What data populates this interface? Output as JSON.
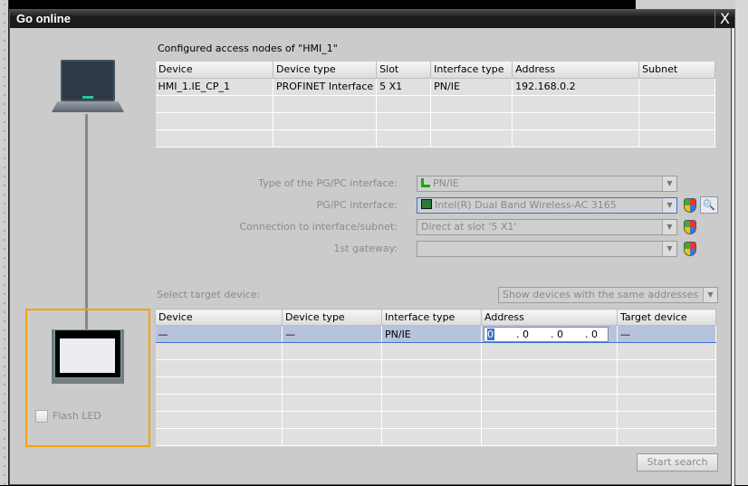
{
  "dialog": {
    "title": "Go online",
    "close_label": "X"
  },
  "configured": {
    "title": "Configured access nodes of \"HMI_1\"",
    "headers": [
      "Device",
      "Device type",
      "Slot",
      "Interface type",
      "Address",
      "Subnet"
    ],
    "rows": [
      [
        "HMI_1.IE_CP_1",
        "PROFINET Interface",
        "5 X1",
        "PN/IE",
        "192.168.0.2",
        ""
      ]
    ]
  },
  "form": {
    "type_label": "Type of the PG/PC interface:",
    "type_value": "PN/IE",
    "pgpc_label": "PG/PC interface:",
    "pgpc_value": "Intel(R) Dual Band Wireless-AC 3165",
    "conn_label": "Connection to interface/subnet:",
    "conn_value": "Direct at slot '5 X1'",
    "gateway_label": "1st gateway:",
    "gateway_value": ""
  },
  "target": {
    "label": "Select target device:",
    "filter": "Show devices with the same addresses",
    "headers": [
      "Device",
      "Device type",
      "Interface type",
      "Address",
      "Target device"
    ],
    "row": {
      "device": "—",
      "device_type": "—",
      "interface_type": "PN/IE",
      "address": [
        "0",
        ". 0",
        ". 0",
        ". 0"
      ],
      "target": "—"
    }
  },
  "flash_led": {
    "label": "Flash LED",
    "checked": false
  },
  "start_search": "Start search"
}
